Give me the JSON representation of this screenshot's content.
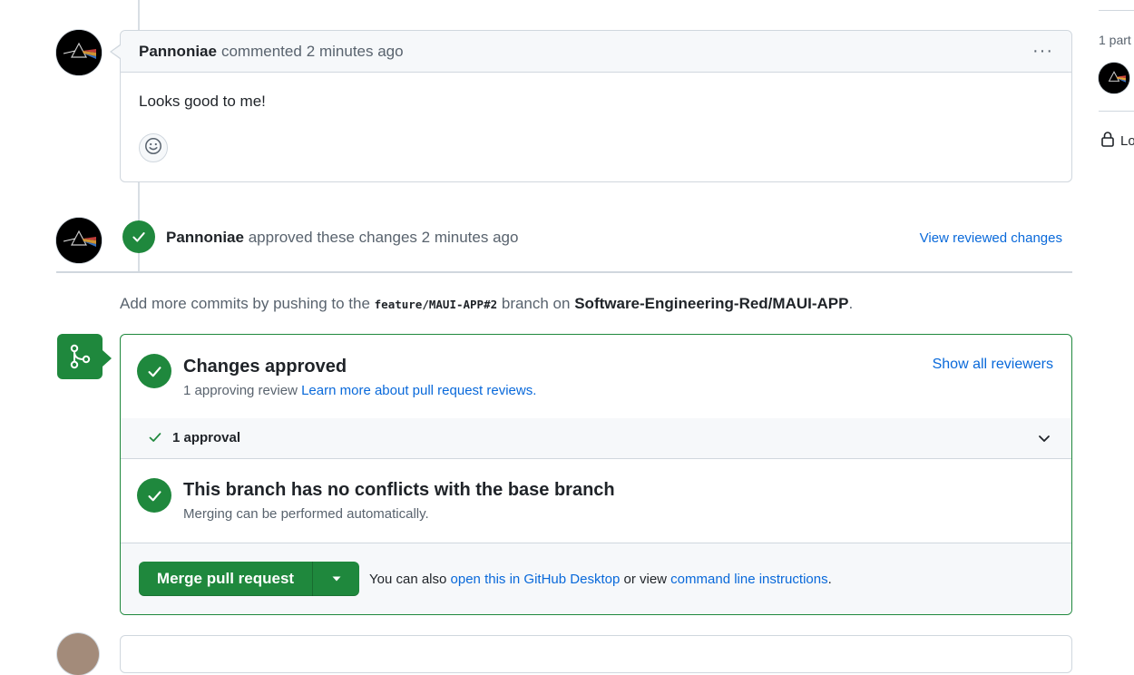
{
  "comment": {
    "author": "Pannoniae",
    "action": "commented",
    "time": "2 minutes ago",
    "more_label": "···",
    "body": "Looks good to me!",
    "reaction_icon": "smiley-icon"
  },
  "review": {
    "author": "Pannoniae",
    "action": "approved these changes",
    "time": "2 minutes ago",
    "view_link": "View reviewed changes"
  },
  "hint": {
    "prefix": "Add more commits by pushing to the",
    "branch": "feature/MAUI-APP#2",
    "middle": "branch on",
    "repo": "Software-Engineering-Red/MAUI-APP",
    "suffix": "."
  },
  "merge_box": {
    "approved_title": "Changes approved",
    "approved_sub_prefix": "1 approving review",
    "approved_sub_link": "Learn more about pull request reviews.",
    "show_all": "Show all reviewers",
    "approvals_label": "1 approval",
    "conflicts_title": "This branch has no conflicts with the base branch",
    "conflicts_sub": "Merging can be performed automatically.",
    "merge_button": "Merge pull request",
    "alt_prefix": "You can also",
    "alt_link1": "open this in GitHub Desktop",
    "alt_middle": "or view",
    "alt_link2": "command line instructions",
    "alt_suffix": "."
  },
  "sidebar": {
    "participants": "1 part",
    "lock_label": "Lo"
  },
  "colors": {
    "accent_green": "#1f883d",
    "link_blue": "#0969da",
    "muted": "#59636e",
    "border": "#d0d7de"
  }
}
